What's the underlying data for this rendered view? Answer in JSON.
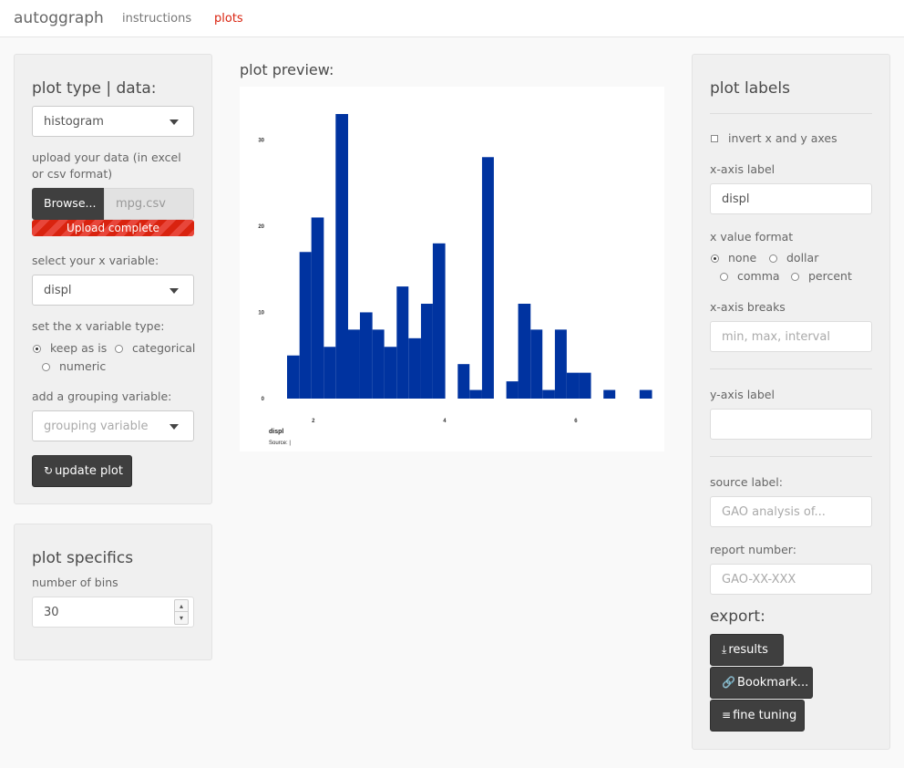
{
  "navbar": {
    "brand": "autoggraph",
    "links": [
      "instructions",
      "plots"
    ]
  },
  "left": {
    "title": "plot type | data:",
    "plot_type": "histogram",
    "upload_label": "upload your data (in excel or csv format)",
    "browse_label": "Browse...",
    "file_name": "mpg.csv",
    "upload_status": "Upload complete",
    "x_var_label": "select your x variable:",
    "x_var": "displ",
    "x_type_label": "set the x variable type:",
    "x_type_options": [
      "keep as is",
      "categorical",
      "numeric"
    ],
    "x_type_selected": "keep as is",
    "group_label": "add a grouping variable:",
    "group_placeholder": "grouping variable",
    "update_button": "update plot"
  },
  "specifics": {
    "title": "plot specifics",
    "bins_label": "number of bins",
    "bins_value": "30"
  },
  "preview": {
    "title": "plot preview:"
  },
  "chart_data": {
    "type": "bar",
    "xlabel": "displ",
    "source_caption": "Source: |",
    "x_ticks": [
      2,
      4,
      6
    ],
    "y_ticks": [
      0,
      10,
      20,
      30
    ],
    "xlim": [
      1.6,
      7.0
    ],
    "ylim": [
      0,
      33
    ],
    "bar_color": "#0033a0",
    "bins": [
      {
        "x0": 1.6,
        "x1": 1.79,
        "y": 5
      },
      {
        "x0": 1.79,
        "x1": 1.97,
        "y": 17
      },
      {
        "x0": 1.97,
        "x1": 2.16,
        "y": 21
      },
      {
        "x0": 2.16,
        "x1": 2.34,
        "y": 6
      },
      {
        "x0": 2.34,
        "x1": 2.53,
        "y": 33
      },
      {
        "x0": 2.53,
        "x1": 2.71,
        "y": 8
      },
      {
        "x0": 2.71,
        "x1": 2.9,
        "y": 10
      },
      {
        "x0": 2.9,
        "x1": 3.08,
        "y": 8
      },
      {
        "x0": 3.08,
        "x1": 3.27,
        "y": 6
      },
      {
        "x0": 3.27,
        "x1": 3.45,
        "y": 13
      },
      {
        "x0": 3.45,
        "x1": 3.64,
        "y": 7
      },
      {
        "x0": 3.64,
        "x1": 3.82,
        "y": 11
      },
      {
        "x0": 3.82,
        "x1": 4.01,
        "y": 18
      },
      {
        "x0": 4.2,
        "x1": 4.38,
        "y": 4
      },
      {
        "x0": 4.38,
        "x1": 4.57,
        "y": 1
      },
      {
        "x0": 4.57,
        "x1": 4.75,
        "y": 28
      },
      {
        "x0": 4.94,
        "x1": 5.12,
        "y": 2
      },
      {
        "x0": 5.12,
        "x1": 5.31,
        "y": 11
      },
      {
        "x0": 5.31,
        "x1": 5.49,
        "y": 8
      },
      {
        "x0": 5.49,
        "x1": 5.68,
        "y": 1
      },
      {
        "x0": 5.68,
        "x1": 5.86,
        "y": 8
      },
      {
        "x0": 5.86,
        "x1": 6.05,
        "y": 3
      },
      {
        "x0": 6.05,
        "x1": 6.23,
        "y": 3
      },
      {
        "x0": 6.42,
        "x1": 6.6,
        "y": 1
      },
      {
        "x0": 6.97,
        "x1": 7.16,
        "y": 1
      }
    ]
  },
  "right": {
    "title": "plot labels",
    "invert_label": "invert x and y axes",
    "xaxis_label": "x-axis label",
    "xaxis_value": "displ",
    "xformat_label": "x value format",
    "xformat_options": [
      "none",
      "dollar",
      "comma",
      "percent"
    ],
    "xformat_selected": "none",
    "xbreaks_label": "x-axis breaks",
    "xbreaks_placeholder": "min, max, interval",
    "yaxis_label": "y-axis label",
    "source_label": "source label:",
    "source_placeholder": "GAO analysis of...",
    "report_label": "report number:",
    "report_placeholder": "GAO-XX-XXX",
    "export_title": "export:",
    "btn_results": "results",
    "btn_bookmark": "Bookmark...",
    "btn_fine": "fine tuning"
  },
  "colors": {
    "accent": "#d9230f",
    "button_dark": "#3f3f3f",
    "bar": "#0033a0"
  },
  "icons": {
    "refresh": "refresh-icon",
    "download": "download-icon",
    "link": "link-icon",
    "sliders": "sliders-icon"
  }
}
